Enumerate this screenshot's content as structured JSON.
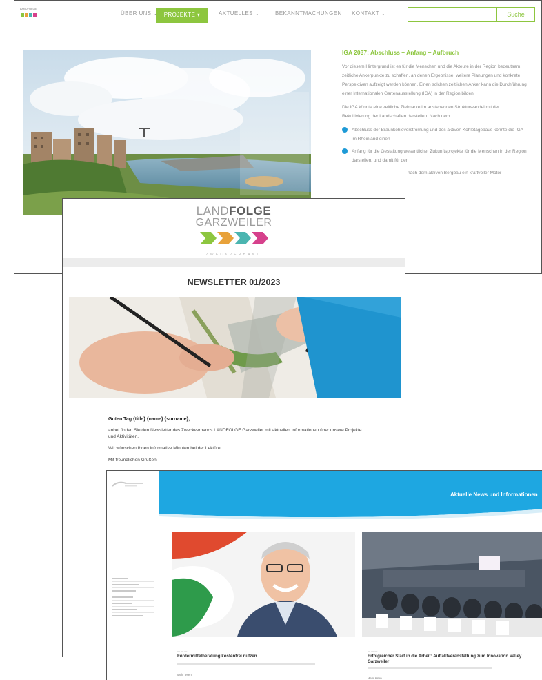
{
  "website": {
    "nav": {
      "items": [
        "ÜBER UNS ⌄",
        "PROJEKTE ▾",
        "AKTUELLES ⌄",
        "BEKANNTMACHUNGEN",
        "KONTAKT ⌄"
      ],
      "search_placeholder": "",
      "search_button": "Suche"
    },
    "article": {
      "title": "IGA 2037: Abschluss – Anfang – Aufbruch",
      "paragraphs": [
        "Vor diesem Hintergrund ist es für die Menschen und die Akteure in der Region bedeutsam, zeitliche Ankerpunkte zu schaffen, an denen Ergebnisse, weitere Planungen und konkrete Perspektiven aufzeigt werden können. Einen solchen zeitlichen Anker kann die Durchführung einer Internationalen Gartenausstellung (IGA) in der Region bilden.",
        "Die IGA könnte eine zeitliche Zielmarke im anstehenden Strukturwandel mit der Rekultivierung der Landschaften darstellen. Nach dem"
      ],
      "bullets": [
        "Abschluss der Braunkohleverstromung und des aktiven Kohletagebaus könnte die IGA im Rheinland einen",
        "Anfang für die Gestaltung wesentlicher Zukunftsprojekte für die Menschen in der Region darstellen, und damit für den",
        "nach dem aktiven Bergbau ein kraftvoller Motor"
      ]
    }
  },
  "newsletter": {
    "logo_line1_light": "LAND",
    "logo_line1_bold": "FOLGE",
    "logo_line2": "GARZWEILER",
    "logo_line3": "ZWECKVERBAND",
    "title": "NEWSLETTER 01/2023",
    "year": "2023",
    "greeting": "Guten Tag {title} {name} {surname},",
    "p1": "anbei finden Sie den Newsletter des Zweckverbands LANDFOLGE Garzweiler mit aktuellen Informationen über unsere Projekte und Aktivitäten.",
    "p2": "Wir wünschen Ihnen informative Minuten bei der Lektüre.",
    "p3": "Mit freundlichen Grüßen"
  },
  "news_site": {
    "band_title": "Aktuelle News und Informationen",
    "cards": [
      {
        "title": "Fördermittelberatung kostenfrei nutzen",
        "more": "Mehr lesen"
      },
      {
        "title": "Erfolgreicher Start in die Arbeit: Auftaktveranstaltung zum Innovation Valley Garzweiler",
        "more": "Mehr lesen"
      }
    ]
  },
  "colors": {
    "green": "#8dc63f",
    "blue": "#1e9ad6",
    "logo_teal": "#4bb5b0",
    "logo_orange": "#e8a23a",
    "logo_pink": "#d6418c"
  }
}
